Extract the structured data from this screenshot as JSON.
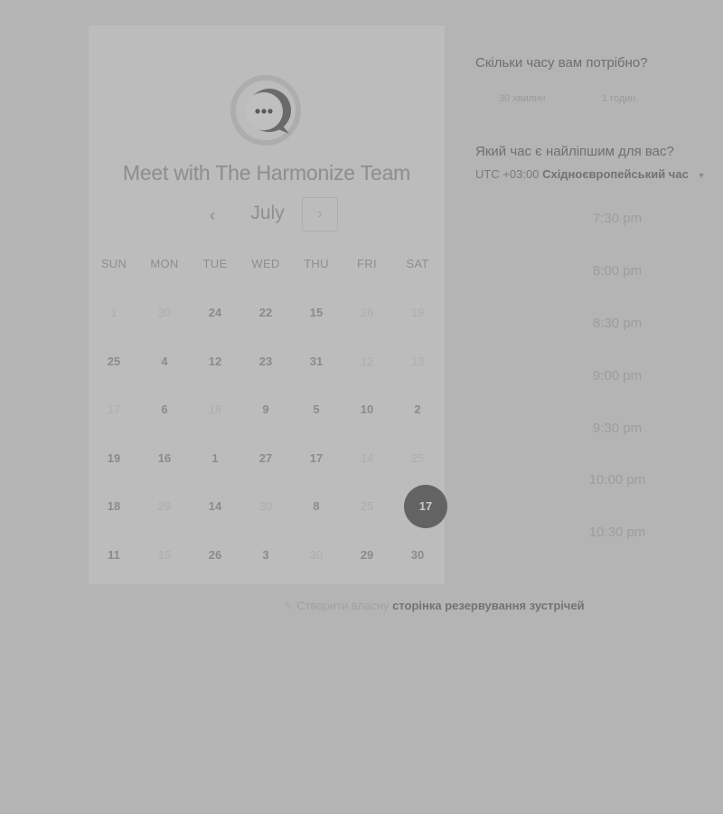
{
  "calendar": {
    "title": "Meet with The Harmonize Team",
    "month": "July",
    "prev_icon": "‹",
    "next_icon": "›",
    "weekdays": [
      "SUN",
      "MON",
      "TUE",
      "WED",
      "THU",
      "FRI",
      "SAT"
    ],
    "weeks": [
      [
        {
          "d": "1",
          "dim": true
        },
        {
          "d": "30",
          "dim": true
        },
        {
          "d": "24",
          "dim": false
        },
        {
          "d": "22",
          "dim": false
        },
        {
          "d": "15",
          "dim": false
        },
        {
          "d": "26",
          "dim": true
        },
        {
          "d": "19",
          "dim": true
        }
      ],
      [
        {
          "d": "25",
          "dim": false
        },
        {
          "d": "4",
          "dim": false
        },
        {
          "d": "12",
          "dim": false
        },
        {
          "d": "23",
          "dim": false
        },
        {
          "d": "31",
          "dim": false
        },
        {
          "d": "12",
          "dim": true
        },
        {
          "d": "13",
          "dim": true
        }
      ],
      [
        {
          "d": "17",
          "dim": true
        },
        {
          "d": "6",
          "dim": false
        },
        {
          "d": "18",
          "dim": true
        },
        {
          "d": "9",
          "dim": false
        },
        {
          "d": "5",
          "dim": false
        },
        {
          "d": "10",
          "dim": false
        },
        {
          "d": "2",
          "dim": false
        }
      ],
      [
        {
          "d": "19",
          "dim": false
        },
        {
          "d": "16",
          "dim": false
        },
        {
          "d": "1",
          "dim": false
        },
        {
          "d": "27",
          "dim": false
        },
        {
          "d": "17",
          "dim": false
        },
        {
          "d": "14",
          "dim": true
        },
        {
          "d": "25",
          "dim": true
        }
      ],
      [
        {
          "d": "18",
          "dim": false
        },
        {
          "d": "29",
          "dim": true
        },
        {
          "d": "14",
          "dim": false
        },
        {
          "d": "30",
          "dim": true
        },
        {
          "d": "8",
          "dim": false
        },
        {
          "d": "25",
          "dim": true
        },
        {
          "d": "17",
          "selected": true
        }
      ],
      [
        {
          "d": "11",
          "dim": false
        },
        {
          "d": "15",
          "dim": true
        },
        {
          "d": "26",
          "dim": false
        },
        {
          "d": "3",
          "dim": false
        },
        {
          "d": "30",
          "dim": true
        },
        {
          "d": "29",
          "dim": false
        },
        {
          "d": "30",
          "dim": false
        }
      ]
    ]
  },
  "duration": {
    "question": "Скільки часу вам потрібно?",
    "options": [
      "30 хвилин",
      "1 годин"
    ]
  },
  "time": {
    "question": "Який час є найліпшим для вас?",
    "tz_offset": "UTC +03:00",
    "tz_name": "Східноєвропейський час",
    "tz_caret": "▼",
    "slots": [
      "7:30 pm",
      "8:00 pm",
      "8:30 pm",
      "9:00 pm",
      "9:30 pm",
      "10:00 pm",
      "10:30 pm"
    ]
  },
  "footer": {
    "icon": "✎",
    "prefix": "Створити власну",
    "link": "сторінка резервування зустрічей"
  },
  "colors": {
    "background": "#b4b4b4",
    "card": "#bcbcbc",
    "selected_day": "#636363"
  }
}
